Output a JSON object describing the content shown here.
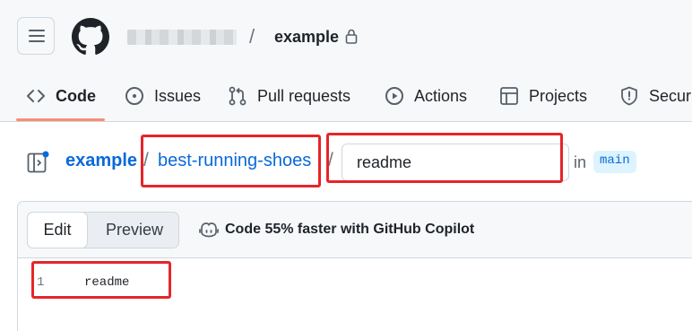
{
  "header": {
    "repo_name": "example",
    "separator": "/"
  },
  "tabs": [
    {
      "label": "Code",
      "icon": "code-icon"
    },
    {
      "label": "Issues",
      "icon": "issue-circle-icon"
    },
    {
      "label": "Pull requests",
      "icon": "pull-request-icon"
    },
    {
      "label": "Actions",
      "icon": "play-circle-icon"
    },
    {
      "label": "Projects",
      "icon": "table-icon"
    },
    {
      "label": "Securi",
      "icon": "shield-icon"
    }
  ],
  "breadcrumb": {
    "repo": "example",
    "sep1": "/",
    "folder": "best-running-shoes",
    "sep2": "/",
    "filename_value": "readme",
    "in_label": "in",
    "branch": "main"
  },
  "editor": {
    "edit_label": "Edit",
    "preview_label": "Preview",
    "copilot_text": "Code 55% faster with GitHub Copilot",
    "lines": [
      {
        "number": "1",
        "text": "readme"
      }
    ]
  },
  "colors": {
    "link": "#0969da",
    "annotation": "#e5252a",
    "tab_underline": "#fd8c73"
  }
}
